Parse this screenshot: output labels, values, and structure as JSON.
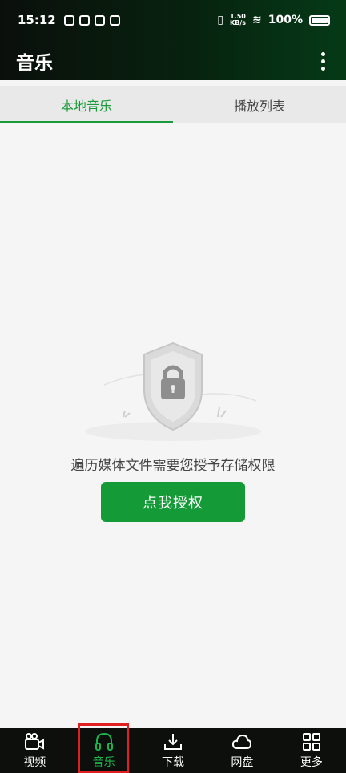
{
  "status_bar": {
    "time": "15:12",
    "network_speed": "1.50\nKB/s",
    "battery": "100%"
  },
  "app_bar": {
    "title": "音乐",
    "menu_icon": "more-vert-icon"
  },
  "tabs": [
    {
      "label": "本地音乐",
      "active": true
    },
    {
      "label": "播放列表",
      "active": false
    }
  ],
  "empty_state": {
    "message": "遍历媒体文件需要您授予存储权限",
    "button_label": "点我授权",
    "illustration_icon": "shield-lock-icon"
  },
  "bottom_nav": [
    {
      "label": "视频",
      "icon": "video-camera-icon",
      "active": false
    },
    {
      "label": "音乐",
      "icon": "headphones-icon",
      "active": true
    },
    {
      "label": "下载",
      "icon": "download-icon",
      "active": false
    },
    {
      "label": "网盘",
      "icon": "cloud-icon",
      "active": false
    },
    {
      "label": "更多",
      "icon": "grid-icon",
      "active": false
    }
  ],
  "colors": {
    "accent": "#1a9a3a",
    "button": "#149a37",
    "highlight": "#e02020"
  }
}
